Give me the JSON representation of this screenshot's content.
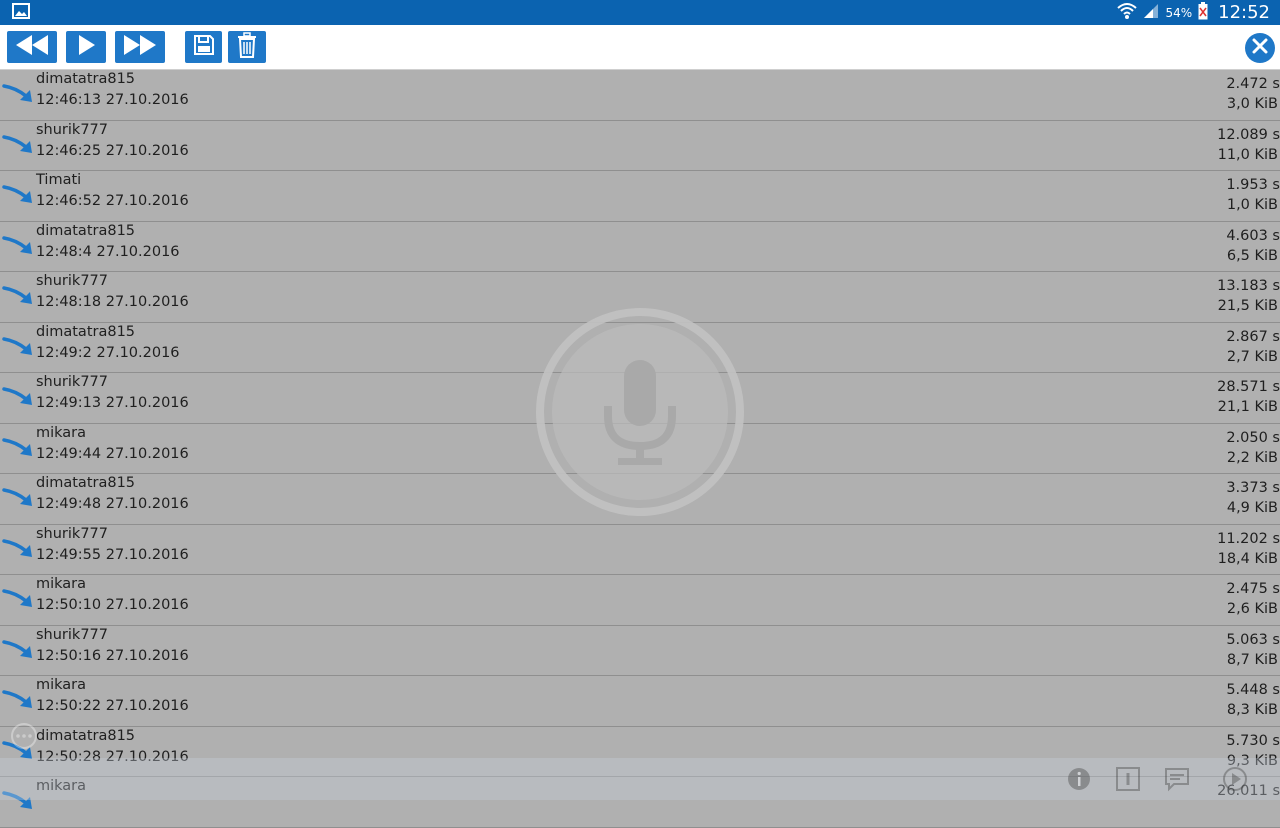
{
  "status": {
    "battery": "54%",
    "time": "12:52"
  },
  "toolbar": {
    "buttons": [
      "rewind-icon",
      "play-icon",
      "fast-forward-icon",
      "save-icon",
      "delete-icon",
      "close-icon"
    ]
  },
  "colors": {
    "status_bar": "#0b63b0",
    "accent": "#1f78c8",
    "list_bg": "#b0b0b0"
  },
  "recordings": [
    {
      "name": "dimatatra815",
      "time": "12:46:13 27.10.2016",
      "duration": "2.472 s",
      "size": "3,0 KiB"
    },
    {
      "name": "shurik777",
      "time": "12:46:25 27.10.2016",
      "duration": "12.089 s",
      "size": "11,0 KiB"
    },
    {
      "name": "Timati",
      "time": "12:46:52 27.10.2016",
      "duration": "1.953 s",
      "size": "1,0 KiB"
    },
    {
      "name": "dimatatra815",
      "time": "12:48:4 27.10.2016",
      "duration": "4.603 s",
      "size": "6,5 KiB"
    },
    {
      "name": "shurik777",
      "time": "12:48:18 27.10.2016",
      "duration": "13.183 s",
      "size": "21,5 KiB"
    },
    {
      "name": "dimatatra815",
      "time": "12:49:2 27.10.2016",
      "duration": "2.867 s",
      "size": "2,7 KiB"
    },
    {
      "name": "shurik777",
      "time": "12:49:13 27.10.2016",
      "duration": "28.571 s",
      "size": "21,1 KiB"
    },
    {
      "name": "mikara",
      "time": "12:49:44 27.10.2016",
      "duration": "2.050 s",
      "size": "2,2 KiB"
    },
    {
      "name": "dimatatra815",
      "time": "12:49:48 27.10.2016",
      "duration": "3.373 s",
      "size": "4,9 KiB"
    },
    {
      "name": "shurik777",
      "time": "12:49:55 27.10.2016",
      "duration": "11.202 s",
      "size": "18,4 KiB"
    },
    {
      "name": "mikara",
      "time": "12:50:10 27.10.2016",
      "duration": "2.475 s",
      "size": "2,6 KiB"
    },
    {
      "name": "shurik777",
      "time": "12:50:16 27.10.2016",
      "duration": "5.063 s",
      "size": "8,7 KiB"
    },
    {
      "name": "mikara",
      "time": "12:50:22 27.10.2016",
      "duration": "5.448 s",
      "size": "8,3 KiB"
    },
    {
      "name": "dimatatra815",
      "time": "12:50:28 27.10.2016",
      "duration": "5.730 s",
      "size": "9,3 KiB"
    },
    {
      "name": "mikara",
      "time": "",
      "duration": "26.011 s",
      "size": ""
    }
  ]
}
